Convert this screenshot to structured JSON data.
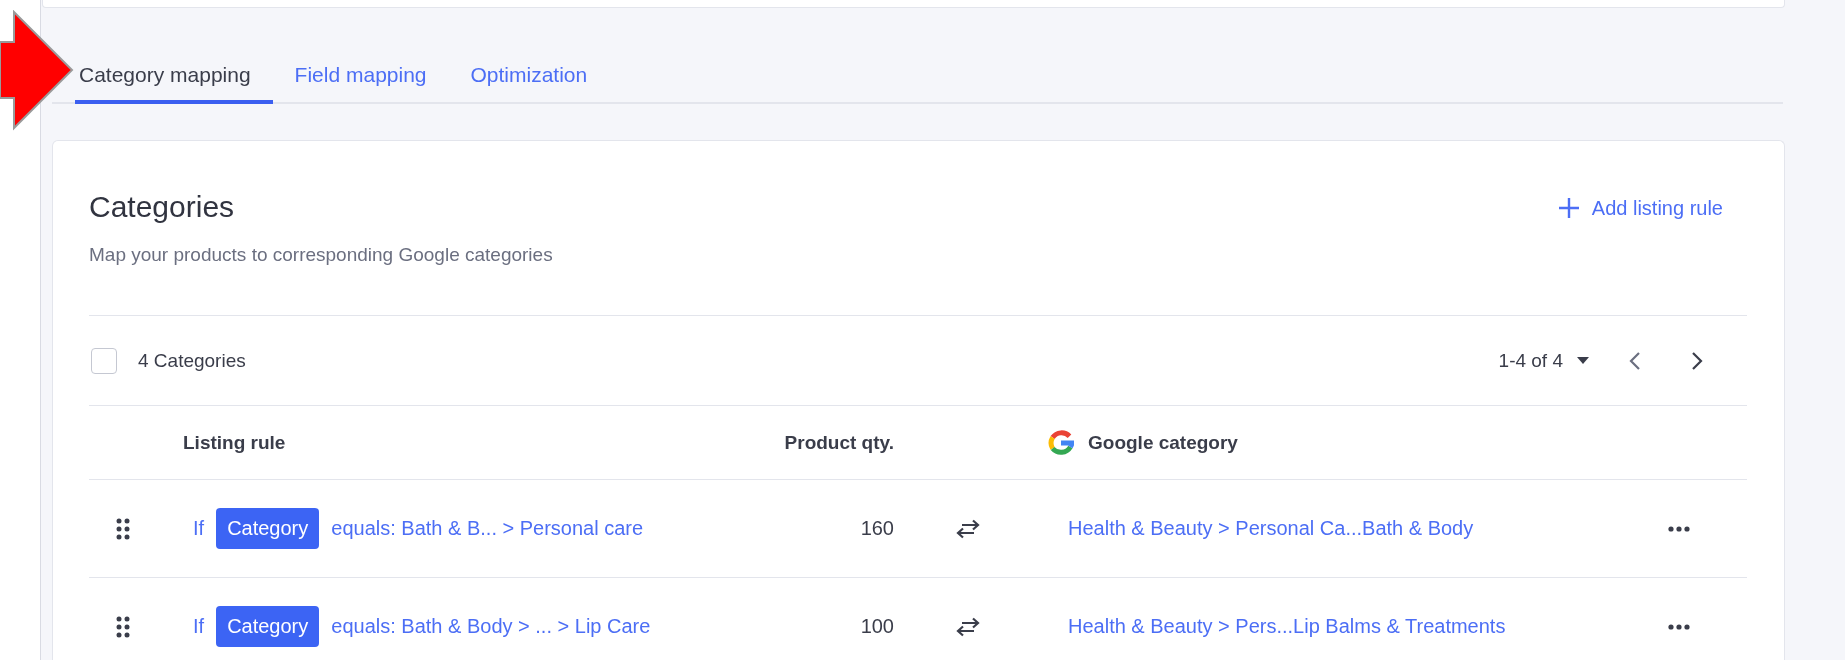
{
  "tabs": [
    {
      "label": "Category mapping",
      "selected": true
    },
    {
      "label": "Field mapping",
      "selected": false
    },
    {
      "label": "Optimization",
      "selected": false
    }
  ],
  "card": {
    "title": "Categories",
    "subtitle": "Map your products to corresponding Google categories",
    "add_button": "Add listing rule"
  },
  "toolbar": {
    "select_all_checked": false,
    "count": "4 Categories",
    "range": "1-4 of 4"
  },
  "table": {
    "columns": [
      "Listing rule",
      "Product qty.",
      "Google category"
    ],
    "rows": [
      {
        "prefix": "If",
        "attribute": "Category",
        "condition": "equals: Bath & B... > Personal care",
        "qty": "160",
        "google_category": "Health & Beauty > Personal Ca...Bath & Body"
      },
      {
        "prefix": "If",
        "attribute": "Category",
        "condition": "equals: Bath & Body > ... > Lip Care",
        "qty": "100",
        "google_category": "Health & Beauty > Pers...Lip Balms & Treatments"
      }
    ]
  }
}
